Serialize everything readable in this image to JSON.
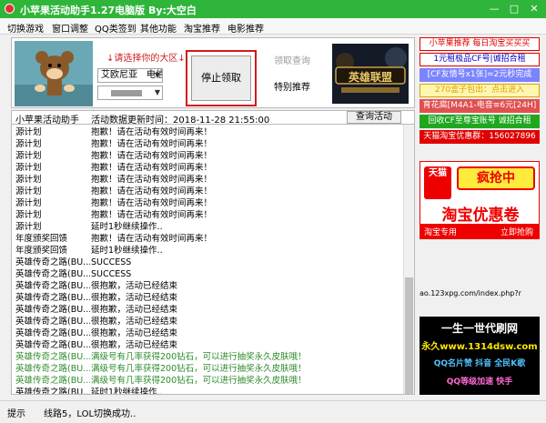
{
  "window": {
    "title": "小苹果活动助手1.27电脑版  By:大空白",
    "minimize": "—",
    "restore": "□",
    "close": "✕"
  },
  "menu": [
    "切换游戏",
    "窗口调整",
    "QQ类签到",
    "其他功能",
    "淘宝推荐",
    "电影推荐"
  ],
  "controls": {
    "select_hint": "↓请选择你的大区↓",
    "region_value": "艾欧尼亚　电信",
    "server_value": "",
    "stop_button": "停止领取",
    "query_button": "领取查询",
    "recommend_button": "特别推荐",
    "lol_banner": "英雄联盟"
  },
  "status": {
    "app": "小苹果活动助手",
    "update_label": "活动数据更新时间：2018-11-28 21:55:00",
    "query_activity": "查询活动"
  },
  "log": [
    {
      "name": "源计划",
      "msg": "抱歉！请在活动有效时间再来！",
      "color": "#000000"
    },
    {
      "name": "源计划",
      "msg": "抱歉！请在活动有效时间再来！",
      "color": "#000000"
    },
    {
      "name": "源计划",
      "msg": "抱歉！请在活动有效时间再来！",
      "color": "#000000"
    },
    {
      "name": "源计划",
      "msg": "抱歉！请在活动有效时间再来！",
      "color": "#000000"
    },
    {
      "name": "源计划",
      "msg": "抱歉！请在活动有效时间再来！",
      "color": "#000000"
    },
    {
      "name": "源计划",
      "msg": "抱歉！请在活动有效时间再来！",
      "color": "#000000"
    },
    {
      "name": "源计划",
      "msg": "抱歉！请在活动有效时间再来！",
      "color": "#000000"
    },
    {
      "name": "源计划",
      "msg": "抱歉！请在活动有效时间再来！",
      "color": "#000000"
    },
    {
      "name": "源计划",
      "msg": "延时1秒继续操作..",
      "color": "#000000"
    },
    {
      "name": "年度颁奖回馈",
      "msg": "抱歉！请在活动有效时间再来！",
      "color": "#000000"
    },
    {
      "name": "年度颁奖回馈",
      "msg": "延时1秒继续操作..",
      "color": "#000000"
    },
    {
      "name": "英雄传奇之路(BU...",
      "msg": "SUCCESS",
      "color": "#000000"
    },
    {
      "name": "英雄传奇之路(BU...",
      "msg": "SUCCESS",
      "color": "#000000"
    },
    {
      "name": "英雄传奇之路(BU...",
      "msg": "很抱歉，活动已经结束",
      "color": "#000000"
    },
    {
      "name": "英雄传奇之路(BU...",
      "msg": "很抱歉，活动已经结束",
      "color": "#000000"
    },
    {
      "name": "英雄传奇之路(BU...",
      "msg": "很抱歉，活动已经结束",
      "color": "#000000"
    },
    {
      "name": "英雄传奇之路(BU...",
      "msg": "很抱歉，活动已经结束",
      "color": "#000000"
    },
    {
      "name": "英雄传奇之路(BU...",
      "msg": "很抱歉，活动已经结束",
      "color": "#000000"
    },
    {
      "name": "英雄传奇之路(BU...",
      "msg": "很抱歉，活动已经结束",
      "color": "#000000"
    },
    {
      "name": "英雄传奇之路(BU...",
      "msg": "满级号有几率获得200钻石，可以进行抽奖永久皮肤哦！",
      "color": "#2e8b2e"
    },
    {
      "name": "英雄传奇之路(BU...",
      "msg": "满级号有几率获得200钻石，可以进行抽奖永久皮肤哦！",
      "color": "#2e8b2e"
    },
    {
      "name": "英雄传奇之路(BU...",
      "msg": "满级号有几率获得200钻石，可以进行抽奖永久皮肤哦！",
      "color": "#2e8b2e"
    },
    {
      "name": "英雄传奇之路(BU...",
      "msg": "延时1秒继续操作..",
      "color": "#000000"
    }
  ],
  "promos": [
    {
      "text": "小苹果推荐 每日淘宝买买买",
      "fg": "#e00000",
      "bg": "#ffffff",
      "border": "#e00000"
    },
    {
      "text": "1元租极品CF号|诚招合租",
      "fg": "#0000c8",
      "bg": "#ffffff",
      "border": "#e00000"
    },
    {
      "text": "[CF友情号x1张]=2元秒完成",
      "fg": "#ffffff",
      "bg": "#7b84ff",
      "border": "#7b84ff"
    },
    {
      "text": "270盒子包出：点击进入",
      "fg": "#e0a000",
      "bg": "#fff6b0",
      "border": "#e0a000"
    },
    {
      "text": "育花腐[M4A1-电音≡6元[24H]",
      "fg": "#ffffff",
      "bg": "#e05050",
      "border": "#e05050"
    },
    {
      "text": "回收CF至尊宝账号 诚招合租",
      "fg": "#ffffff",
      "bg": "#1fa81f",
      "border": "#1fa81f"
    },
    {
      "text": "天猫淘宝优惠群：156027896",
      "fg": "#ffffff",
      "bg": "#e00000",
      "border": "#e00000"
    }
  ],
  "ads": {
    "tmall_logo": "天猫",
    "tmall_headline": "疯抢中",
    "tmall_sub": "淘宝优惠卷",
    "tmall_footer_left": "淘宝专用",
    "tmall_footer_right": "立即抢购",
    "url": "ao.123xpg.com/index.php?r",
    "black_line1": "一生一世代刷网",
    "black_line2": "永久www.1314dsw.com",
    "black_line3": "QQ名片赞 抖音 全民K歌",
    "black_line4": "QQ等级加速 快手"
  },
  "statusbar": {
    "label": "提示",
    "message": "线路5，LOL切换成功.."
  }
}
